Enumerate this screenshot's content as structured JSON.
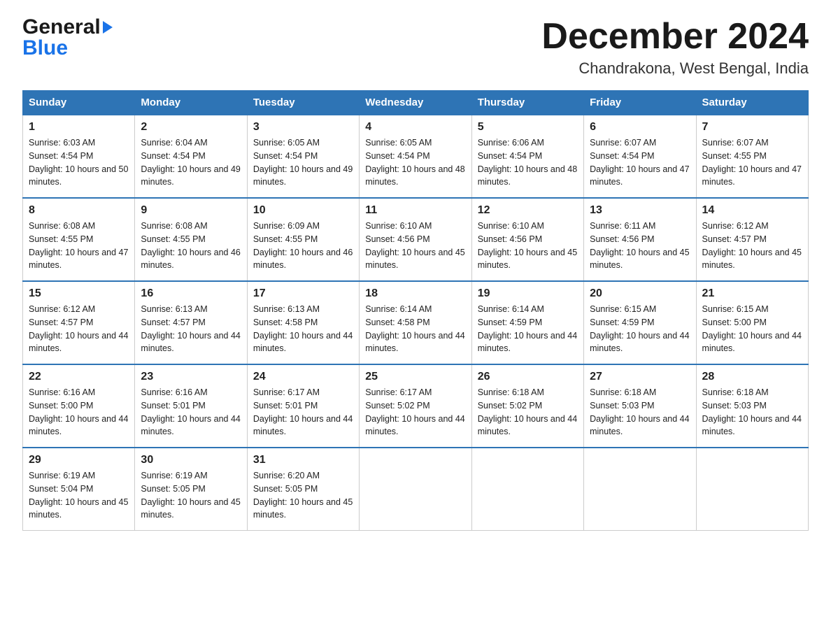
{
  "logo": {
    "line1": "General",
    "line2": "Blue"
  },
  "header": {
    "month_title": "December 2024",
    "subtitle": "Chandrakona, West Bengal, India"
  },
  "weekdays": [
    "Sunday",
    "Monday",
    "Tuesday",
    "Wednesday",
    "Thursday",
    "Friday",
    "Saturday"
  ],
  "weeks": [
    [
      {
        "day": "1",
        "sunrise": "6:03 AM",
        "sunset": "4:54 PM",
        "daylight": "10 hours and 50 minutes."
      },
      {
        "day": "2",
        "sunrise": "6:04 AM",
        "sunset": "4:54 PM",
        "daylight": "10 hours and 49 minutes."
      },
      {
        "day": "3",
        "sunrise": "6:05 AM",
        "sunset": "4:54 PM",
        "daylight": "10 hours and 49 minutes."
      },
      {
        "day": "4",
        "sunrise": "6:05 AM",
        "sunset": "4:54 PM",
        "daylight": "10 hours and 48 minutes."
      },
      {
        "day": "5",
        "sunrise": "6:06 AM",
        "sunset": "4:54 PM",
        "daylight": "10 hours and 48 minutes."
      },
      {
        "day": "6",
        "sunrise": "6:07 AM",
        "sunset": "4:54 PM",
        "daylight": "10 hours and 47 minutes."
      },
      {
        "day": "7",
        "sunrise": "6:07 AM",
        "sunset": "4:55 PM",
        "daylight": "10 hours and 47 minutes."
      }
    ],
    [
      {
        "day": "8",
        "sunrise": "6:08 AM",
        "sunset": "4:55 PM",
        "daylight": "10 hours and 47 minutes."
      },
      {
        "day": "9",
        "sunrise": "6:08 AM",
        "sunset": "4:55 PM",
        "daylight": "10 hours and 46 minutes."
      },
      {
        "day": "10",
        "sunrise": "6:09 AM",
        "sunset": "4:55 PM",
        "daylight": "10 hours and 46 minutes."
      },
      {
        "day": "11",
        "sunrise": "6:10 AM",
        "sunset": "4:56 PM",
        "daylight": "10 hours and 45 minutes."
      },
      {
        "day": "12",
        "sunrise": "6:10 AM",
        "sunset": "4:56 PM",
        "daylight": "10 hours and 45 minutes."
      },
      {
        "day": "13",
        "sunrise": "6:11 AM",
        "sunset": "4:56 PM",
        "daylight": "10 hours and 45 minutes."
      },
      {
        "day": "14",
        "sunrise": "6:12 AM",
        "sunset": "4:57 PM",
        "daylight": "10 hours and 45 minutes."
      }
    ],
    [
      {
        "day": "15",
        "sunrise": "6:12 AM",
        "sunset": "4:57 PM",
        "daylight": "10 hours and 44 minutes."
      },
      {
        "day": "16",
        "sunrise": "6:13 AM",
        "sunset": "4:57 PM",
        "daylight": "10 hours and 44 minutes."
      },
      {
        "day": "17",
        "sunrise": "6:13 AM",
        "sunset": "4:58 PM",
        "daylight": "10 hours and 44 minutes."
      },
      {
        "day": "18",
        "sunrise": "6:14 AM",
        "sunset": "4:58 PM",
        "daylight": "10 hours and 44 minutes."
      },
      {
        "day": "19",
        "sunrise": "6:14 AM",
        "sunset": "4:59 PM",
        "daylight": "10 hours and 44 minutes."
      },
      {
        "day": "20",
        "sunrise": "6:15 AM",
        "sunset": "4:59 PM",
        "daylight": "10 hours and 44 minutes."
      },
      {
        "day": "21",
        "sunrise": "6:15 AM",
        "sunset": "5:00 PM",
        "daylight": "10 hours and 44 minutes."
      }
    ],
    [
      {
        "day": "22",
        "sunrise": "6:16 AM",
        "sunset": "5:00 PM",
        "daylight": "10 hours and 44 minutes."
      },
      {
        "day": "23",
        "sunrise": "6:16 AM",
        "sunset": "5:01 PM",
        "daylight": "10 hours and 44 minutes."
      },
      {
        "day": "24",
        "sunrise": "6:17 AM",
        "sunset": "5:01 PM",
        "daylight": "10 hours and 44 minutes."
      },
      {
        "day": "25",
        "sunrise": "6:17 AM",
        "sunset": "5:02 PM",
        "daylight": "10 hours and 44 minutes."
      },
      {
        "day": "26",
        "sunrise": "6:18 AM",
        "sunset": "5:02 PM",
        "daylight": "10 hours and 44 minutes."
      },
      {
        "day": "27",
        "sunrise": "6:18 AM",
        "sunset": "5:03 PM",
        "daylight": "10 hours and 44 minutes."
      },
      {
        "day": "28",
        "sunrise": "6:18 AM",
        "sunset": "5:03 PM",
        "daylight": "10 hours and 44 minutes."
      }
    ],
    [
      {
        "day": "29",
        "sunrise": "6:19 AM",
        "sunset": "5:04 PM",
        "daylight": "10 hours and 45 minutes."
      },
      {
        "day": "30",
        "sunrise": "6:19 AM",
        "sunset": "5:05 PM",
        "daylight": "10 hours and 45 minutes."
      },
      {
        "day": "31",
        "sunrise": "6:20 AM",
        "sunset": "5:05 PM",
        "daylight": "10 hours and 45 minutes."
      },
      null,
      null,
      null,
      null
    ]
  ],
  "labels": {
    "sunrise_prefix": "Sunrise: ",
    "sunset_prefix": "Sunset: ",
    "daylight_prefix": "Daylight: "
  }
}
